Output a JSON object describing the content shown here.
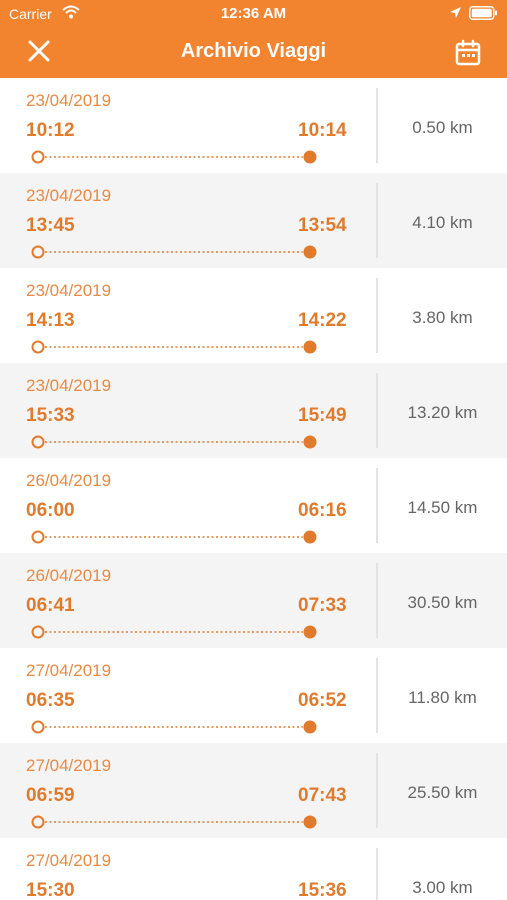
{
  "status_bar": {
    "carrier": "Carrier",
    "time": "12:36 AM"
  },
  "nav": {
    "title": "Archivio Viaggi",
    "close_icon": "close-icon",
    "calendar_icon": "calendar-icon"
  },
  "colors": {
    "accent": "#f2832f",
    "time_text": "#e07b2e",
    "row_alt_bg": "#f4f4f4",
    "distance_text": "#666666"
  },
  "trips": [
    {
      "date": "23/04/2019",
      "start": "10:12",
      "end": "10:14",
      "distance": "0.50 km"
    },
    {
      "date": "23/04/2019",
      "start": "13:45",
      "end": "13:54",
      "distance": "4.10 km"
    },
    {
      "date": "23/04/2019",
      "start": "14:13",
      "end": "14:22",
      "distance": "3.80 km"
    },
    {
      "date": "23/04/2019",
      "start": "15:33",
      "end": "15:49",
      "distance": "13.20 km"
    },
    {
      "date": "26/04/2019",
      "start": "06:00",
      "end": "06:16",
      "distance": "14.50 km"
    },
    {
      "date": "26/04/2019",
      "start": "06:41",
      "end": "07:33",
      "distance": "30.50 km"
    },
    {
      "date": "27/04/2019",
      "start": "06:35",
      "end": "06:52",
      "distance": "11.80 km"
    },
    {
      "date": "27/04/2019",
      "start": "06:59",
      "end": "07:43",
      "distance": "25.50 km"
    },
    {
      "date": "27/04/2019",
      "start": "15:30",
      "end": "15:36",
      "distance": "3.00 km"
    }
  ]
}
